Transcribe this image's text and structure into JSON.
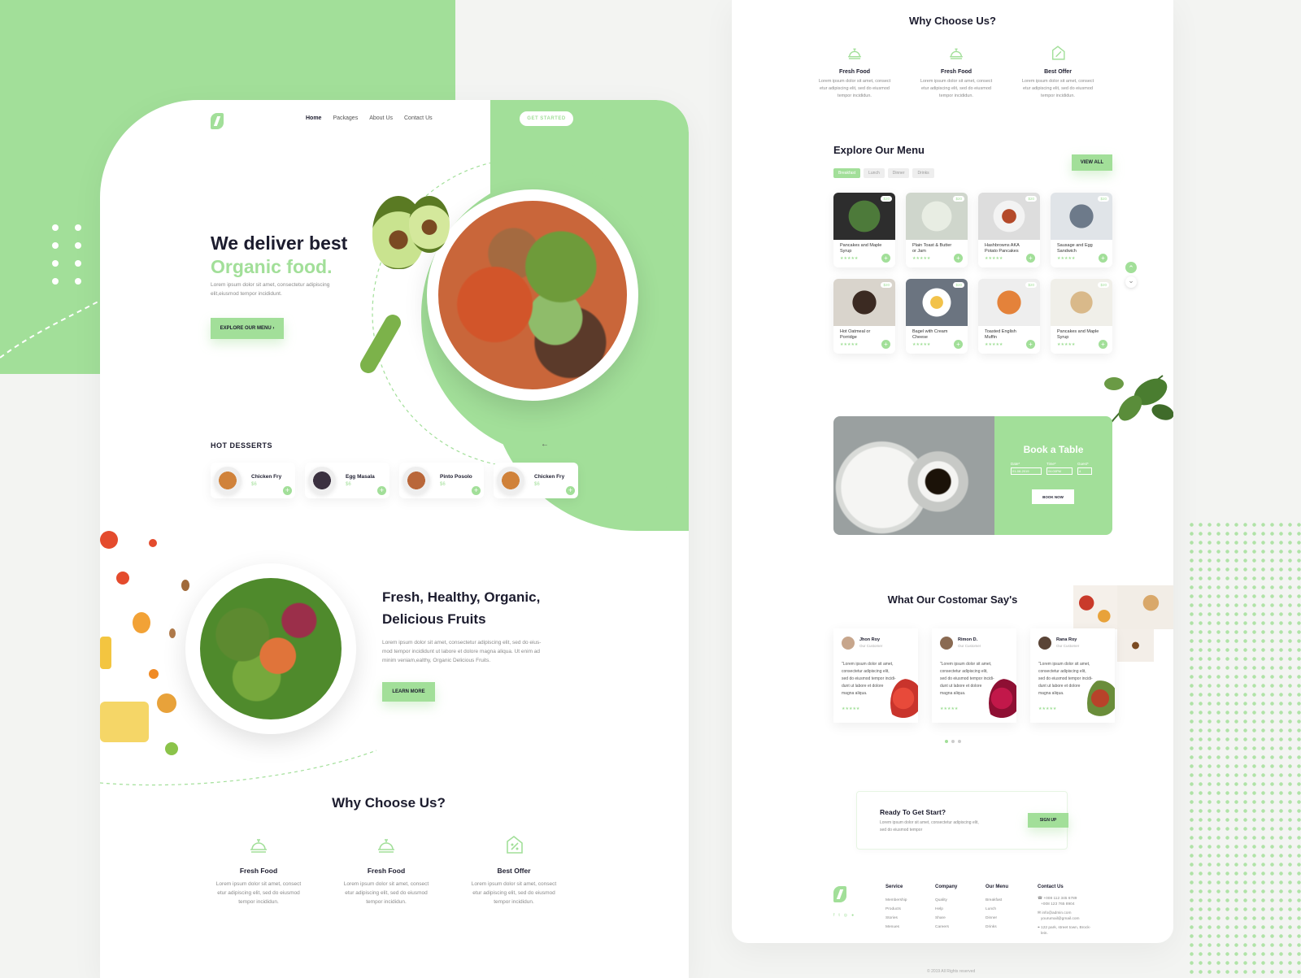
{
  "colors": {
    "accent": "#a2df99",
    "dark": "#1c1c2e"
  },
  "left": {
    "nav": {
      "items": [
        "Home",
        "Packages",
        "About Us",
        "Contact Us"
      ],
      "cta": "GET STARTED"
    },
    "hero": {
      "line1": "We deliver best",
      "line2": "Organic food.",
      "desc1": "Lorem ipsum dolor sit amet, consectetur adipiscing",
      "desc2": "elit,eiusmod tempor incididunt.",
      "button": "EXPLORE OUR MENU",
      "button_icon": "›"
    },
    "desserts": {
      "title": "HOT DESSERTS",
      "prev": "←",
      "next": "→",
      "items": [
        {
          "name": "Chicken Fry",
          "price": "$6"
        },
        {
          "name": "Egg Masala",
          "price": "$6"
        },
        {
          "name": "Pinto Posolo",
          "price": "$6"
        },
        {
          "name": "Chicken Fry",
          "price": "$6"
        }
      ]
    },
    "fruits": {
      "line1": "Fresh, Healthy, Organic,",
      "line2": "Delicious Fruits",
      "d1": "Lorem ipsum dolor sit amet, consectetur adipiscing elit, sed do eius-",
      "d2": "mod tempor incididunt ut labore et dolore magna aliqua. Ut enim ad",
      "d3": "minim veniam,ealthy, Organic Delicious Fruits.",
      "button": "LEARN MORE"
    },
    "why": {
      "title": "Why Choose Us?",
      "features": [
        {
          "title": "Fresh Food",
          "d1": "Lorem ipsum dolor sit amet, consect",
          "d2": "etur adipiscing elit, sed do eiusmod",
          "d3": "tempor incididun."
        },
        {
          "title": "Fresh Food",
          "d1": "Lorem ipsum dolor sit amet, consect",
          "d2": "etur adipiscing elit, sed do eiusmod",
          "d3": "tempor incididun."
        },
        {
          "title": "Best Offer",
          "d1": "Lorem ipsum dolor sit amet, consect",
          "d2": "etur adipiscing elit, sed do eiusmod",
          "d3": "tempor incididun."
        }
      ]
    }
  },
  "right": {
    "why": {
      "title": "Why Choose Us?",
      "features": [
        {
          "title": "Fresh Food",
          "d1": "Lorem ipsum dolor sit amet, consect",
          "d2": "etur adipiscing elit, sed do eiusmod",
          "d3": "tempor incididun."
        },
        {
          "title": "Fresh Food",
          "d1": "Lorem ipsum dolor sit amet, consect",
          "d2": "etur adipiscing elit, sed do eiusmod",
          "d3": "tempor incididun."
        },
        {
          "title": "Best Offer",
          "d1": "Lorem ipsum dolor sit amet, consect",
          "d2": "etur adipiscing elit, sed do eiusmod",
          "d3": "tempor incididun."
        }
      ]
    },
    "menu": {
      "title": "Explore Our Menu",
      "view_all": "VIEW ALL",
      "tabs": [
        "Breakfast",
        "Lunch",
        "Dinner",
        "Drinks"
      ],
      "stars": "★★★★★",
      "badge": "$20",
      "items": [
        {
          "n1": "Pancakes and Maple",
          "n2": "Syrup"
        },
        {
          "n1": "Plain Toast & Butter",
          "n2": "or Jam"
        },
        {
          "n1": "Hashbrowns AKA",
          "n2": "Potato Pancakes"
        },
        {
          "n1": "Sausage and Egg",
          "n2": "Sandwich"
        },
        {
          "n1": "Hot Oatmeal or",
          "n2": "Porridge"
        },
        {
          "n1": "Bagel with Cream",
          "n2": "Cheese"
        },
        {
          "n1": "Toasted English",
          "n2": "Muffin"
        },
        {
          "n1": "Pancakes and Maple",
          "n2": "Syrup"
        }
      ],
      "up": "⌃",
      "down": "⌄"
    },
    "book": {
      "title": "Book a Table",
      "date_label": "Date*",
      "time_label": "Time*",
      "guest_label": "Guest*",
      "date": "01-08-2019",
      "time": "04:00PM",
      "guest": "4",
      "button": "BOOK NOW"
    },
    "testimonials": {
      "title": "What Our Costomar Say's",
      "role": "Our Customer",
      "stars": "★★★★★",
      "items": [
        {
          "name": "Jhon Roy",
          "t1": "\"Lorem ipsum dolor sit amet,",
          "t2": "consectetur adipiscing elit,",
          "t3": "sed do eiusmod tempor incidi-",
          "t4": "dunt ut labore et dolore",
          "t5": "magna aliqua."
        },
        {
          "name": "Rimon D.",
          "t1": "\"Lorem ipsum dolor sit amet,",
          "t2": "consectetur adipiscing elit,",
          "t3": "sed do eiusmod tempor incidi-",
          "t4": "dunt ut labore et dolore",
          "t5": "magna aliqua."
        },
        {
          "name": "Rana Roy",
          "t1": "\"Lorem ipsum dolor sit amet,",
          "t2": "consectetur adipiscing elit,",
          "t3": "sed do eiusmod tempor incidi-",
          "t4": "dunt ut labore et dolore",
          "t5": "magna aliqua."
        }
      ]
    },
    "cta": {
      "title": "Ready To Get Start?",
      "d1": "Lorem ipsum dolor sit amet, consectetur adipiscing elit,",
      "d2": "sed do eiusmod tempor",
      "button": "SIGN UP"
    },
    "footer": {
      "cols": [
        {
          "title": "Service",
          "links": [
            "Membership",
            "Products",
            "Stories",
            "Menues"
          ]
        },
        {
          "title": "Company",
          "links": [
            "Quality",
            "Help",
            "Share",
            "Careers"
          ]
        },
        {
          "title": "Our Menu",
          "links": [
            "Breakfast",
            "Lunch",
            "Dinner",
            "Drinks"
          ]
        }
      ],
      "contact": {
        "title": "Contact Us",
        "phone1": "+008 112 345 6789",
        "phone2": "+008 123 765 8904",
        "email1": "info@admin.com",
        "email2": "yourumail@gmail.com",
        "address1": "122 park, street town, Brock-",
        "address2": "lein."
      },
      "copyright": "© 2019 All Rights reserved"
    }
  }
}
